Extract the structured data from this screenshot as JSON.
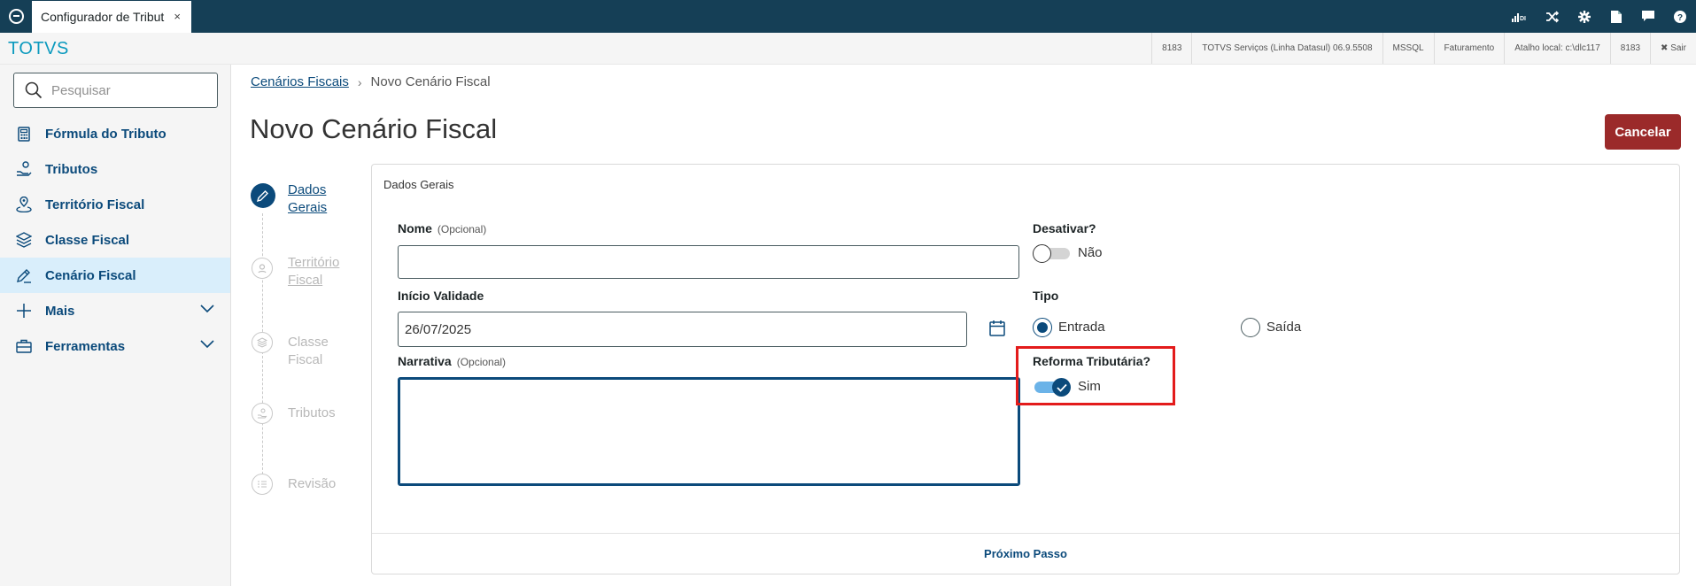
{
  "window": {
    "tab_title": "Configurador de Tribut",
    "tab_close": "×",
    "sys_icons": [
      "signal-icon",
      "shuffle-icon",
      "gear-icon",
      "document-icon",
      "chat-icon",
      "help-icon"
    ],
    "sys_icon_glyphs": {
      "signal": "DI",
      "help": "?"
    }
  },
  "header": {
    "brand": "TOTVS",
    "info": [
      "8183",
      "TOTVS Serviços (Linha Datasul) 06.9.5508",
      "MSSQL",
      "Faturamento",
      "Atalho local: c:\\dlc117",
      "8183"
    ],
    "exit_label": "✖ Sair"
  },
  "sidebar": {
    "search_placeholder": "Pesquisar",
    "items": [
      {
        "label": "Fórmula do Tributo",
        "icon": "calculator-icon"
      },
      {
        "label": "Tributos",
        "icon": "hand-coin-icon"
      },
      {
        "label": "Território Fiscal",
        "icon": "map-pin-icon"
      },
      {
        "label": "Classe Fiscal",
        "icon": "layers-icon"
      },
      {
        "label": "Cenário Fiscal",
        "icon": "pencil-icon",
        "active": true
      },
      {
        "label": "Mais",
        "icon": "plus-icon",
        "expandable": true
      },
      {
        "label": "Ferramentas",
        "icon": "toolbox-icon",
        "expandable": true
      }
    ]
  },
  "breadcrumb": {
    "parent": "Cenários Fiscais",
    "separator": "›",
    "current": "Novo Cenário Fiscal"
  },
  "page": {
    "title": "Novo Cenário Fiscal",
    "cancel_label": "Cancelar"
  },
  "stepper": {
    "steps": [
      {
        "label_line1": "Dados",
        "label_line2": "Gerais",
        "state": "active"
      },
      {
        "label_line1": "Território",
        "label_line2": "Fiscal",
        "state": "inactive"
      },
      {
        "label_line1": "Classe Fiscal",
        "label_line2": "",
        "state": "inactive"
      },
      {
        "label_line1": "Tributos",
        "label_line2": "",
        "state": "inactive"
      },
      {
        "label_line1": "Revisão",
        "label_line2": "",
        "state": "inactive"
      }
    ]
  },
  "form": {
    "section_title": "Dados Gerais",
    "nome": {
      "label": "Nome",
      "optional": "(Opcional)",
      "value": ""
    },
    "inicio_validade": {
      "label": "Início Validade",
      "value": "26/07/2025"
    },
    "narrativa": {
      "label": "Narrativa",
      "optional": "(Opcional)",
      "value": ""
    },
    "desativar": {
      "label": "Desativar?",
      "state_label": "Não",
      "checked": false
    },
    "tipo": {
      "label": "Tipo",
      "options": [
        "Entrada",
        "Saída"
      ],
      "selected": "Entrada"
    },
    "reforma": {
      "label": "Reforma Tributária?",
      "state_label": "Sim",
      "checked": true
    },
    "next_label": "Próximo Passo"
  },
  "colors": {
    "titlebar": "#153f56",
    "brand": "#0c9abe",
    "primary": "#0b4a7b",
    "cancel": "#9b2a2a",
    "highlight": "#e31b1b",
    "active_menu": "#d9eefb"
  }
}
